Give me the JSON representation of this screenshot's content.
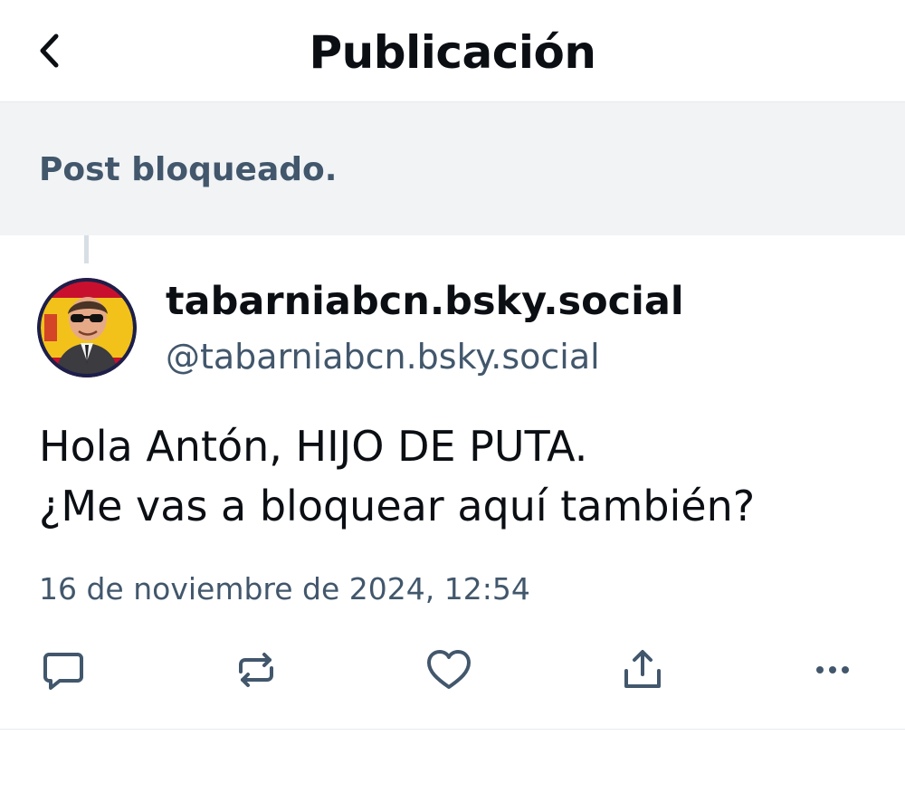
{
  "header": {
    "title": "Publicación",
    "back_icon": "chevron-left-icon"
  },
  "blocked_banner": {
    "text": "Post bloqueado."
  },
  "post": {
    "author": {
      "display_name": "tabarniabcn.bsky.social",
      "handle": "@tabarniabcn.bsky.social",
      "avatar": "avatar"
    },
    "text_lines": [
      "Hola Antón, HIJO DE PUTA.",
      "¿Me vas a bloquear aquí también?"
    ],
    "timestamp": "16 de noviembre de 2024, 12:54",
    "actions": [
      "reply-icon",
      "repost-icon",
      "heart-icon",
      "share-icon",
      "more-icon"
    ]
  },
  "colors": {
    "text_primary": "#0b0f14",
    "text_secondary": "#42576c",
    "banner_bg": "#f1f3f5",
    "divider": "#e6eaef"
  }
}
